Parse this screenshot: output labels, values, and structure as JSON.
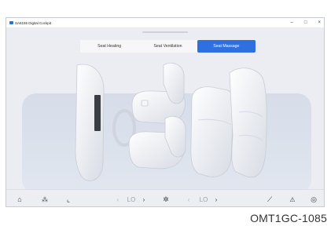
{
  "window": {
    "title": "SA8155 Digital Cockpit",
    "controls": [
      "–",
      "□",
      "×"
    ]
  },
  "tabs": [
    {
      "label": "Seat Heating",
      "active": false
    },
    {
      "label": "Seat Ventilation",
      "active": false
    },
    {
      "label": "Seat Massage",
      "active": true
    }
  ],
  "bottom_bar": {
    "left_icons": [
      "home-icon",
      "apps-grid-icon",
      "seat-icon"
    ],
    "left_level": {
      "prev": "‹",
      "value": "LO",
      "next": "›"
    },
    "center_icon": "fan-icon",
    "right_level": {
      "prev": "‹",
      "value": "LO",
      "next": "›"
    },
    "right_icons": [
      "wiper-icon",
      "warning-icon",
      "steering-wheel-icon"
    ]
  },
  "glyphs": {
    "home": "⌂",
    "apps": "⁂",
    "seat": "⌞",
    "fan": "✲",
    "wiper": "⟋",
    "warning": "⚠",
    "wheel": "◎"
  },
  "watermark": "OMT1GC-1085"
}
